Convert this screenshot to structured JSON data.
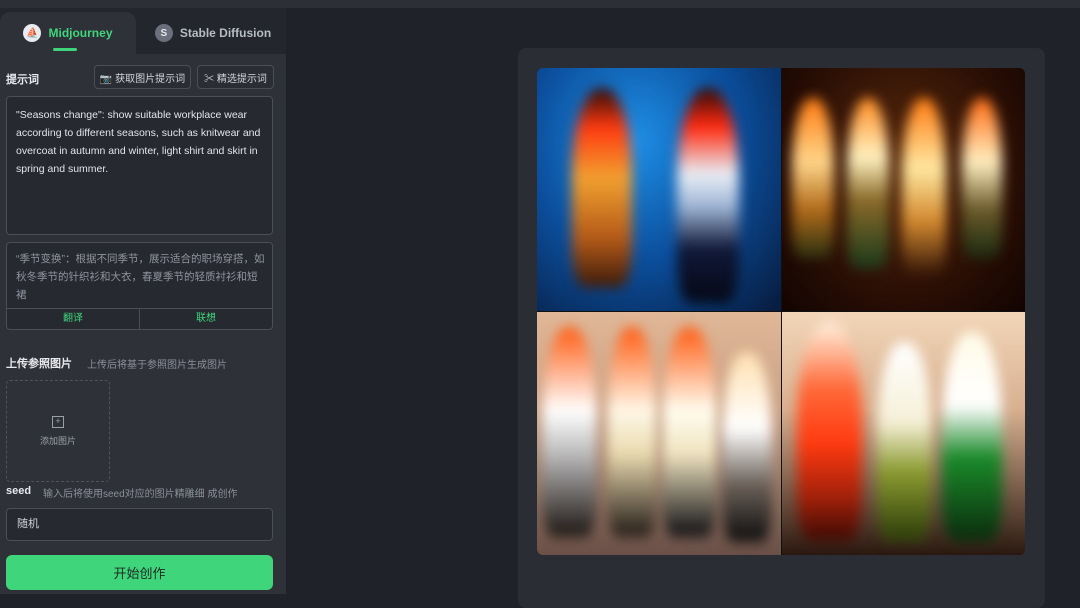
{
  "tabs": [
    {
      "label": "Midjourney",
      "logo": "⛵",
      "active": true
    },
    {
      "label": "Stable Diffusion",
      "logo": "S",
      "active": false
    }
  ],
  "prompt": {
    "title": "提示词",
    "btn_style": "📷 获取图片提示词",
    "btn_preset": "✂ 精选提示词",
    "text": "\"Seasons change\": show suitable workplace wear according to different seasons, such as knitwear and overcoat in autumn and winter, light shirt and skirt in spring and summer.",
    "translation": "“季节变换”：根据不同季节，展示适合的职场穿搭，如秋冬季节的针织衫和大衣，春夏季节的轻质衬衫和短裙",
    "translate_label": "翻译",
    "associate_label": "联想"
  },
  "upload": {
    "title": "上传参照图片",
    "hint": "上传后将基于参照图片生成图片",
    "button_label": "添加图片",
    "icon": "plus-icon"
  },
  "seed": {
    "title": "seed",
    "hint": "输入后将使用seed对应的图片精雕细 成创作",
    "value": "随机"
  },
  "submit_label": "开始创作",
  "colors": {
    "accent": "#3fd57b",
    "panel": "#2e3138",
    "background": "#1f2228"
  }
}
